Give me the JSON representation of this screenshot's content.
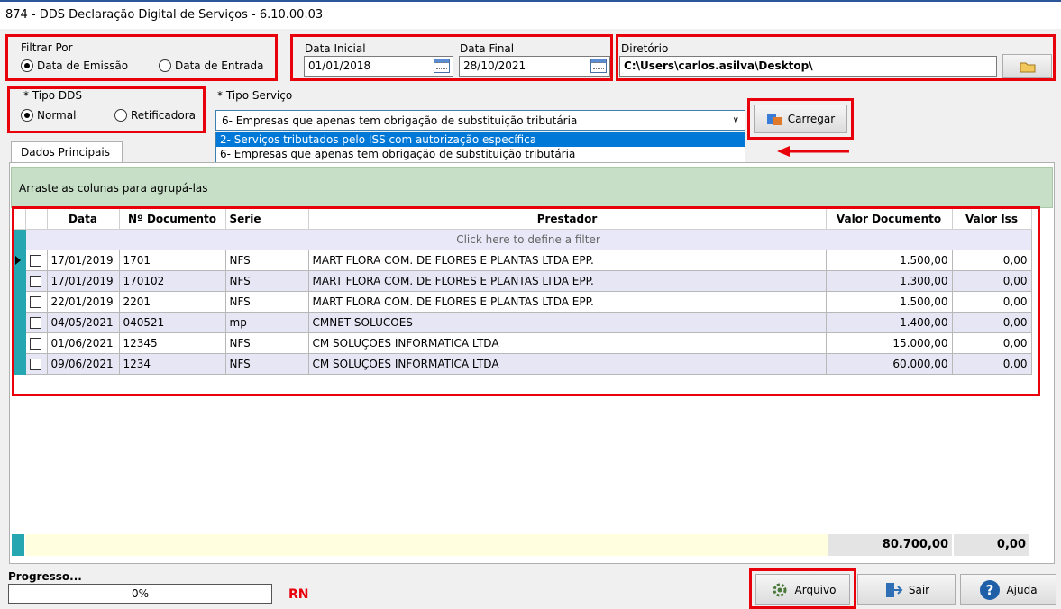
{
  "window": {
    "title": "874 - DDS Declaração Digital de Serviços - 6.10.00.03"
  },
  "filtrar": {
    "label": "Filtrar Por",
    "options": [
      "Data de Emissão",
      "Data de Entrada"
    ],
    "selected": "Data de Emissão"
  },
  "datas": {
    "inicial_label": "Data Inicial",
    "inicial_value": "01/01/2018",
    "final_label": "Data Final",
    "final_value": "28/10/2021"
  },
  "diretorio": {
    "label": "Diretório",
    "value": "C:\\Users\\carlos.asilva\\Desktop\\"
  },
  "tipo_dds": {
    "label": "* Tipo DDS",
    "options": [
      "Normal",
      "Retificadora"
    ],
    "selected": "Normal"
  },
  "tipo_servico": {
    "label": "* Tipo Serviço",
    "value": "6- Empresas que apenas tem obrigação de substituição tributária",
    "options": [
      "2- Serviços tributados pelo ISS com autorização específica",
      "6- Empresas que apenas tem obrigação de substituição tributária"
    ],
    "highlighted": "2- Serviços tributados pelo ISS com autorização específica"
  },
  "carregar_label": "Carregar",
  "tabs": [
    "Dados Principais"
  ],
  "group_hint": "Arraste as colunas para agrupá-las",
  "grid": {
    "columns": [
      "Data",
      "Nº Documento",
      "Serie",
      "Prestador",
      "Valor Documento",
      "Valor Iss"
    ],
    "filter_hint": "Click here to define a filter",
    "rows": [
      {
        "data": "17/01/2019",
        "doc": "1701",
        "serie": "NFS",
        "prestador": " MART FLORA COM. DE FLORES E PLANTAS LTDA EPP.",
        "valor": "1.500,00",
        "iss": "0,00"
      },
      {
        "data": "17/01/2019",
        "doc": "170102",
        "serie": "NFS",
        "prestador": " MART FLORA COM. DE FLORES E PLANTAS LTDA EPP.",
        "valor": "1.300,00",
        "iss": "0,00"
      },
      {
        "data": "22/01/2019",
        "doc": "2201",
        "serie": "NFS",
        "prestador": " MART FLORA COM. DE FLORES E PLANTAS LTDA EPP.",
        "valor": "1.500,00",
        "iss": "0,00"
      },
      {
        "data": "04/05/2021",
        "doc": "040521",
        "serie": "mp",
        "prestador": "CMNET SOLUCOES",
        "valor": "1.400,00",
        "iss": "0,00"
      },
      {
        "data": "01/06/2021",
        "doc": "12345",
        "serie": "NFS",
        "prestador": "CM SOLUÇOES INFORMATICA LTDA",
        "valor": "15.000,00",
        "iss": "0,00"
      },
      {
        "data": "09/06/2021",
        "doc": "1234",
        "serie": "NFS",
        "prestador": "CM SOLUÇOES INFORMATICA LTDA",
        "valor": "60.000,00",
        "iss": "0,00"
      }
    ],
    "total_valor": "80.700,00",
    "total_iss": "0,00"
  },
  "progresso": {
    "label": "Progresso...",
    "value": "0%"
  },
  "rn": "RN",
  "buttons": {
    "arquivo": "Arquivo",
    "sair": "Sair",
    "ajuda": "Ajuda"
  }
}
